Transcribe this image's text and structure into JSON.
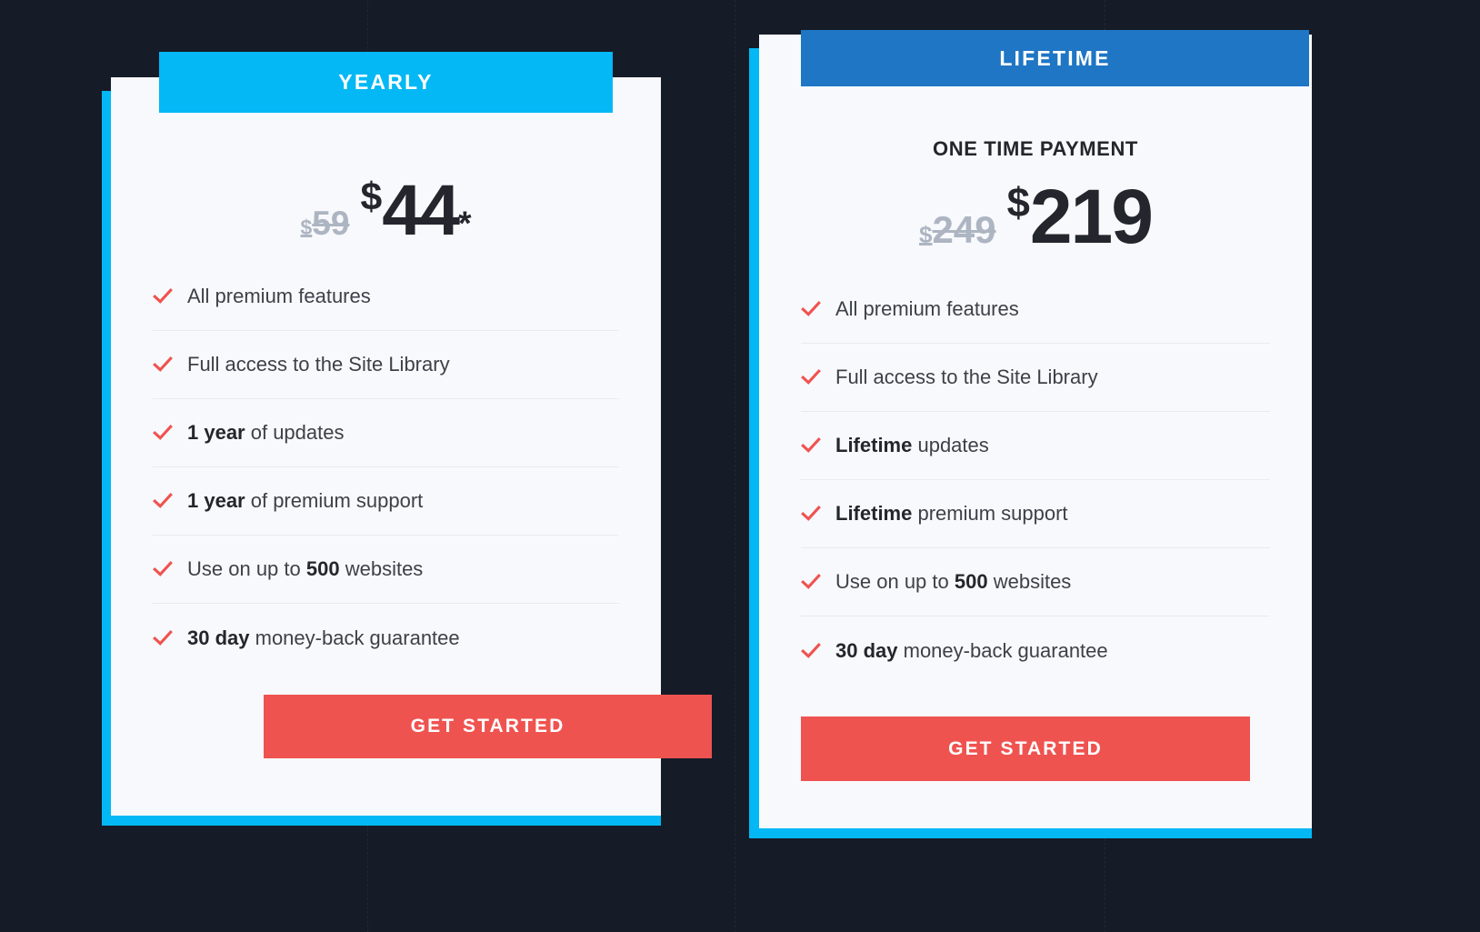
{
  "theme": {
    "background": "#161b28",
    "card_background": "#f8f9fc",
    "accent_cyan": "#03b8f4",
    "accent_blue": "#1f76c4",
    "accent_red": "#ef5350",
    "text_dark": "#23262c",
    "text_muted": "#adb5c2",
    "divider": "#e9ebf0"
  },
  "plans": [
    {
      "id": "yearly",
      "tab_label": "YEARLY",
      "subtitle": "",
      "old_price_currency": "$",
      "old_price_amount": "59",
      "new_price_currency": "$",
      "new_price_amount": "44",
      "price_suffix": "*",
      "features": [
        {
          "lead": "",
          "text": "All premium features"
        },
        {
          "lead": "",
          "text": "Full access to the Site Library"
        },
        {
          "lead": "1 year",
          "text": " of updates"
        },
        {
          "lead": "1 year",
          "text": " of premium support"
        },
        {
          "lead": "",
          "text": "Use on up to ",
          "bold_mid": "500",
          "tail": " websites"
        },
        {
          "lead": "30 day",
          "text": " money-back guarantee"
        }
      ],
      "cta_label": "GET STARTED"
    },
    {
      "id": "lifetime",
      "tab_label": "LIFETIME",
      "subtitle": "ONE TIME PAYMENT",
      "old_price_currency": "$",
      "old_price_amount": "249",
      "new_price_currency": "$",
      "new_price_amount": "219",
      "price_suffix": "",
      "features": [
        {
          "lead": "",
          "text": "All premium features"
        },
        {
          "lead": "",
          "text": "Full access to the Site Library"
        },
        {
          "lead": "Lifetime",
          "text": " updates"
        },
        {
          "lead": "Lifetime",
          "text": " premium support"
        },
        {
          "lead": "",
          "text": "Use on up to ",
          "bold_mid": "500",
          "tail": " websites"
        },
        {
          "lead": "30 day",
          "text": " money-back guarantee"
        }
      ],
      "cta_label": "GET STARTED"
    }
  ],
  "background_guides": {
    "dashed_line_x": [
      404,
      808,
      1215
    ]
  },
  "icons": {
    "feature_marker": "check-icon"
  }
}
